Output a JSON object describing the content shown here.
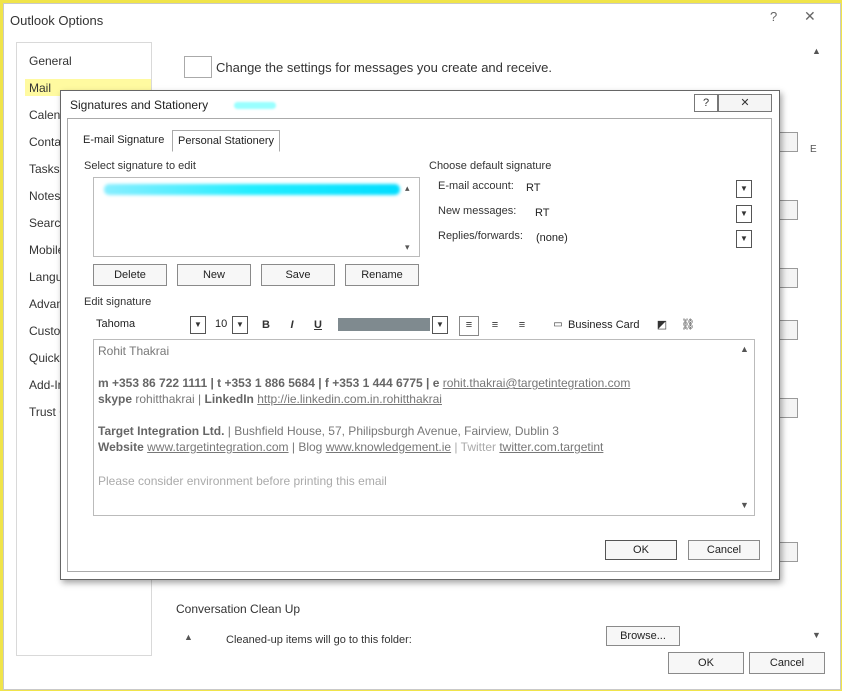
{
  "window": {
    "title": "Outlook Options",
    "help_glyph": "?",
    "close_glyph": "✕"
  },
  "nav": [
    "General",
    "Mail",
    "Calendar",
    "Contacts",
    "Tasks",
    "Notes and Journal",
    "Search",
    "Mobile",
    "Language",
    "Advanced",
    "Customize Ribbon",
    "Quick Access Toolbar",
    "Add-Ins",
    "Trust Center"
  ],
  "nav_visible": [
    "General",
    "Mail",
    "Calend",
    "Conta",
    "Tasks",
    "Notes",
    "Search",
    "Mobile",
    "Langua",
    "Advan",
    "Custom",
    "Quick",
    "Add-In",
    "Trust C"
  ],
  "content": {
    "intro": "Change the settings for messages you create and receive.",
    "clean_up_title": "Conversation Clean Up",
    "clean_up_folder_label": "Cleaned-up items will go to this folder:",
    "browse_label": "Browse...",
    "ok_label": "OK",
    "cancel_label": "Cancel"
  },
  "dialog": {
    "title": "Signatures and Stationery",
    "help_glyph": "?",
    "close_glyph": "✕",
    "tabs": [
      "E-mail Signature",
      "Personal Stationery"
    ],
    "select_label": "Select signature to edit",
    "default_label": "Choose default signature",
    "email_account_label": "E-mail account:",
    "email_account_value": "RT",
    "new_messages_label": "New messages:",
    "new_messages_value": "RT",
    "replies_label": "Replies/forwards:",
    "replies_value": "(none)",
    "delete_label": "Delete",
    "new_label": "New",
    "save_label": "Save",
    "rename_label": "Rename",
    "edit_label": "Edit signature",
    "font_name": "Tahoma",
    "font_size": "10",
    "bold": "B",
    "italic": "I",
    "underline": "U",
    "business_card": "Business Card",
    "ok_label": "OK",
    "cancel_label": "Cancel",
    "signature": {
      "name": "Rohit Thakrai",
      "contact": "m +353 86 722 1111 | t +353 1 886 5684 | f +353 1 444 6775 | e ",
      "email": "rohit.thakrai@targetintegration.com",
      "skype_label": "skype",
      "skype_value": " rohitthakrai | ",
      "linkedin_label": "LinkedIn",
      "linkedin_url": "http://ie.linkedin.com.in.rohitthakrai",
      "company": "Target Integration Ltd.",
      "address": " | Bushfield House, 57, Philipsburgh Avenue, Fairview, Dublin 3",
      "website_label": "Website",
      "website_url": "www.targetintegration.com",
      "blog_text": " | Blog ",
      "blog_url": "www.knowledgement.ie",
      "twitter_text": " | Twitter ",
      "twitter_url": "twitter.com.targetint",
      "footer": "Please consider environment before printing this email"
    }
  }
}
